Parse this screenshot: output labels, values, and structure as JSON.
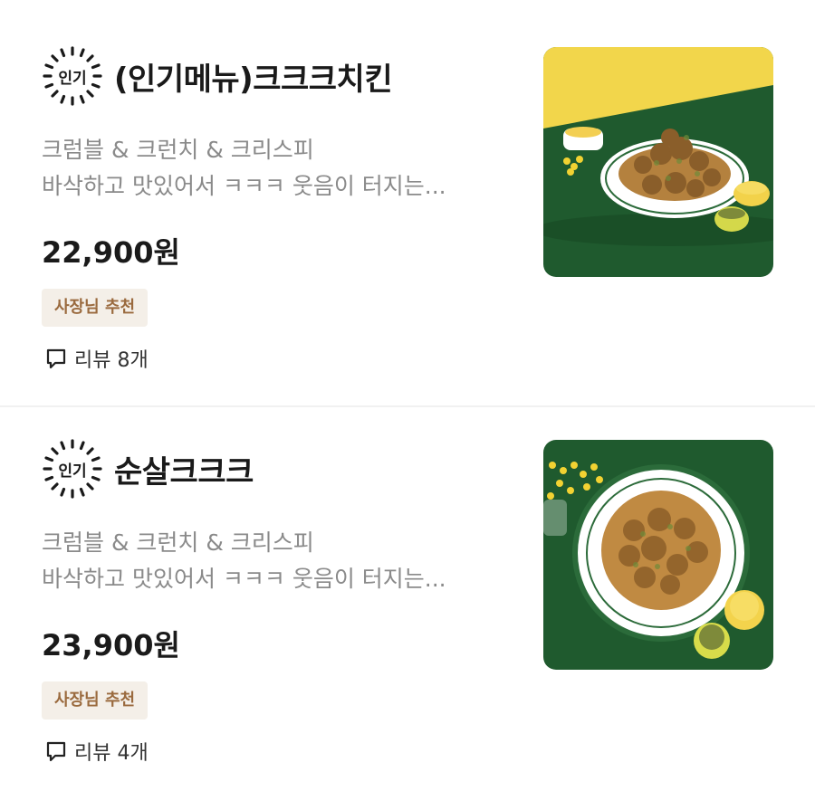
{
  "items": [
    {
      "badge_label": "인기",
      "name": "(인기메뉴)크크크치킨",
      "desc_line1": "크럼블 & 크런치 & 크리스피",
      "desc_line2": "바삭하고 맛있어서 ㅋㅋㅋ 웃음이 터지는...",
      "price": "22,900원",
      "tag": "사장님 추천",
      "reviews": "리뷰 8개"
    },
    {
      "badge_label": "인기",
      "name": "순살크크크",
      "desc_line1": "크럼블 & 크런치 & 크리스피",
      "desc_line2": "바삭하고 맛있어서 ㅋㅋㅋ 웃음이 터지는...",
      "price": "23,900원",
      "tag": "사장님 추천",
      "reviews": "리뷰 4개"
    }
  ],
  "colors": {
    "tag_bg": "#f4efe8",
    "tag_text": "#9a6a3e",
    "photo_green": "#1f5a2e",
    "photo_yellow": "#f2d64b"
  },
  "icons": {
    "badge": "popular-burst-badge",
    "reviews": "chat-bubble-icon"
  }
}
